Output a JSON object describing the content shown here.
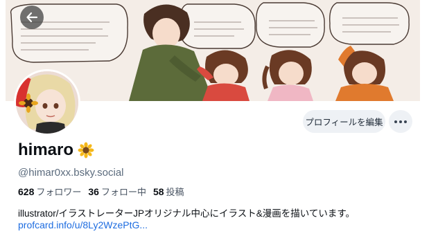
{
  "profile": {
    "display_name": "himaro",
    "name_emoji": "sunflower-icon",
    "handle": "@himar0xx.bsky.social",
    "bio": "illustrator/イラストレーターJPオリジナル中心にイラスト&漫画を描いています。",
    "link": "profcard.info/u/8Ly2WzePtG..."
  },
  "stats": {
    "followers": {
      "count": "628",
      "label": "フォロワー"
    },
    "following": {
      "count": "36",
      "label": "フォロー中"
    },
    "posts": {
      "count": "58",
      "label": "投稿"
    }
  },
  "actions": {
    "edit_profile_label": "プロフィールを編集",
    "more_icon": "more-horizontal-icon",
    "back_icon": "arrow-left-icon"
  },
  "colors": {
    "link": "#1d6ce0",
    "button_bg": "#eef1f5",
    "muted": "#5b6b7d"
  }
}
